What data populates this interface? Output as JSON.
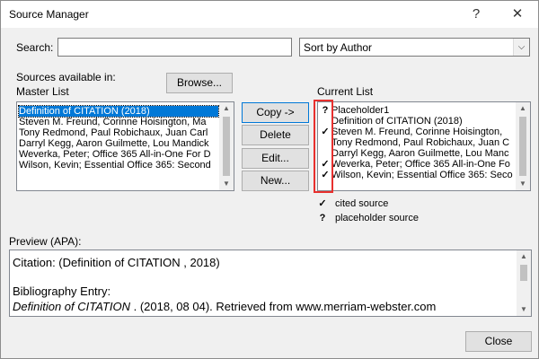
{
  "window": {
    "title": "Source Manager",
    "help_glyph": "?",
    "close_glyph": "✕"
  },
  "search": {
    "label": "Search:",
    "value": "",
    "sort_selected": "Sort by Author",
    "sort_arrow": "⌵"
  },
  "sources": {
    "label_line1": "Sources available in:",
    "label_line2": "Master List",
    "browse_label": "Browse...",
    "master_items": [
      "Definition of CITATION  (2018)",
      "Steven M. Freund, Corinne Hoisington, Ma",
      "Tony Redmond, Paul Robichaux, Juan Carl",
      "Darryl Kegg, Aaron Guilmette, Lou Mandick",
      "Weverka, Peter; Office 365 All-in-One For D",
      "Wilson, Kevin; Essential Office 365: Second"
    ],
    "selected_index": 0
  },
  "actions": {
    "copy": "Copy ->",
    "delete": "Delete",
    "edit": "Edit...",
    "new": "New..."
  },
  "current": {
    "label": "Current List",
    "items": [
      {
        "mark": "?",
        "text": "Placeholder1"
      },
      {
        "mark": "",
        "text": "Definition of CITATION  (2018)"
      },
      {
        "mark": "✓",
        "text": "Steven M. Freund, Corinne Hoisington,"
      },
      {
        "mark": "",
        "text": "Tony Redmond, Paul Robichaux, Juan C"
      },
      {
        "mark": "",
        "text": "Darryl Kegg, Aaron Guilmette, Lou Manc"
      },
      {
        "mark": "✓",
        "text": "Weverka, Peter; Office 365 All-in-One Fo"
      },
      {
        "mark": "✓",
        "text": "Wilson, Kevin; Essential Office 365: Seco"
      }
    ]
  },
  "legend": {
    "cited_mark": "✓",
    "cited_label": "cited source",
    "placeholder_mark": "?",
    "placeholder_label": "placeholder source"
  },
  "preview": {
    "label": "Preview (APA):",
    "citation": "Citation:  (Definition of CITATION , 2018)",
    "bib_heading": "Bibliography Entry:",
    "bib_italic": "Definition of CITATION",
    "bib_rest": " . (2018, 08 04). Retrieved from www.merriam-webster.com"
  },
  "footer": {
    "close_label": "Close"
  },
  "colors": {
    "selection": "#0078d7",
    "highlight_box": "#e8302e",
    "focus_border": "#0078d7"
  },
  "icons": {
    "scroll_up": "▲",
    "scroll_down": "▼"
  }
}
